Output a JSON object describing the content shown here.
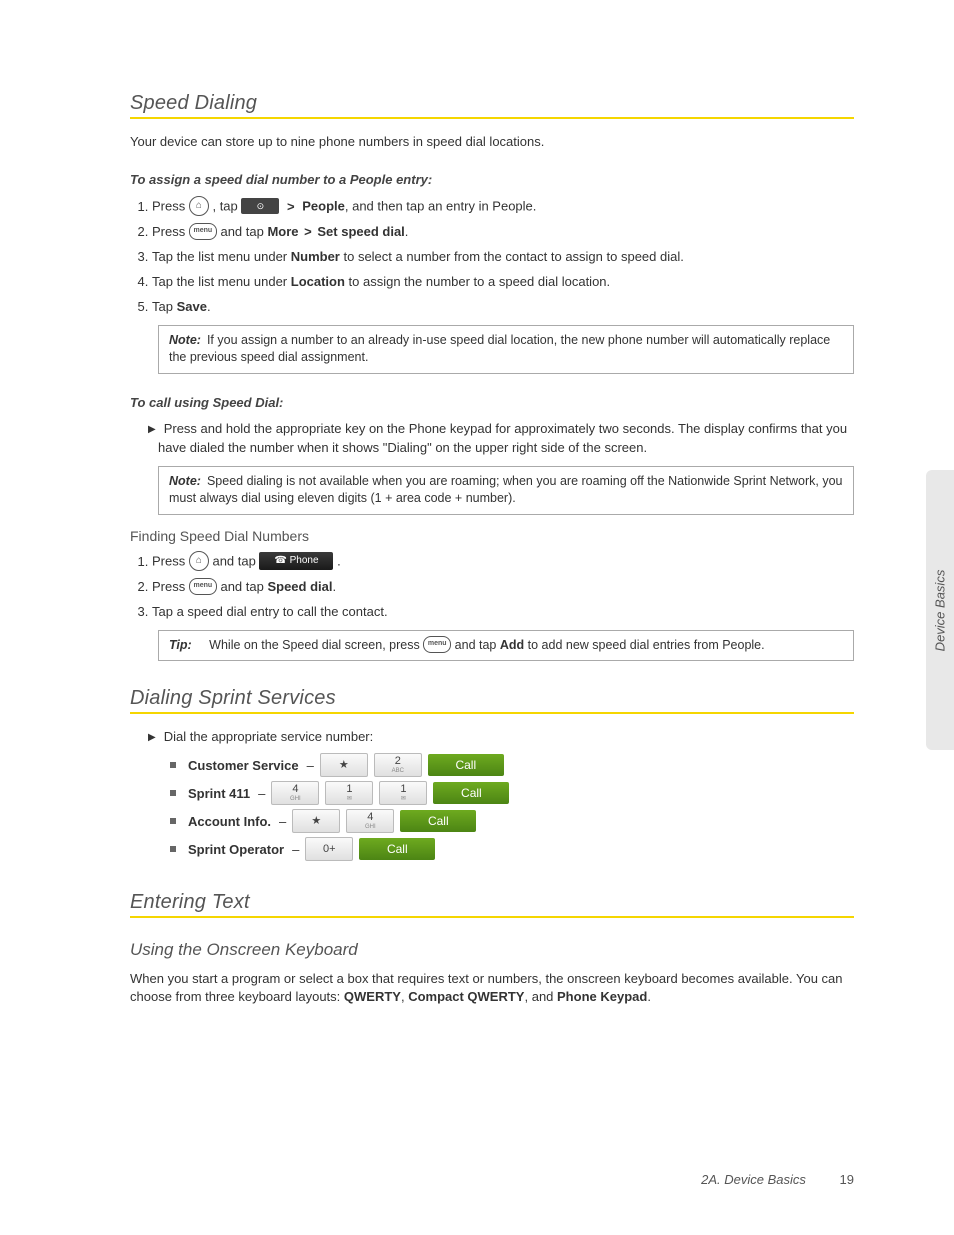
{
  "sideTab": "Device Basics",
  "footer": {
    "section": "2A. Device Basics",
    "page": "19"
  },
  "speedDialing": {
    "heading": "Speed Dialing",
    "intro": "Your device can store up to nine phone numbers in speed dial locations.",
    "assignHead": "To assign a speed dial number to a People entry:",
    "step1a": "Press ",
    "step1b": ", tap ",
    "step1c": "People",
    "step1d": ", and then tap an entry in People.",
    "step2a": "Press ",
    "step2b": " and tap ",
    "step2c": "More",
    "step2d": "Set speed dial",
    "step3a": "Tap the list menu under ",
    "step3b": "Number",
    "step3c": " to select a number from the contact to assign to speed dial.",
    "step4a": "Tap the list menu under ",
    "step4b": "Location",
    "step4c": " to assign the number to a speed dial location.",
    "step5a": "Tap ",
    "step5b": "Save",
    "note1Label": "Note:",
    "note1": "If you assign a number to an already in-use speed dial location, the new phone number will automatically replace the previous speed dial assignment.",
    "callHead": "To call using Speed Dial:",
    "callBody": "Press and hold the appropriate key on the Phone keypad for approximately two seconds. The display confirms that you have dialed the number when it shows \"Dialing\" on the upper right side of the screen.",
    "note2Label": "Note:",
    "note2": "Speed dialing is not available when you are roaming; when you are roaming off the Nationwide Sprint Network, you must always dial using eleven digits (1 + area code + number).",
    "findHead": "Finding Speed Dial Numbers",
    "find1a": "Press ",
    "find1b": " and tap ",
    "find2a": "Press ",
    "find2b": " and tap ",
    "find2c": "Speed dial",
    "find3": "Tap a speed dial entry to call the contact.",
    "tipLabel": "Tip:",
    "tipA": "While on the Speed dial screen, press ",
    "tipB": " and tap ",
    "tipC": "Add",
    "tipD": " to add new speed dial entries from People."
  },
  "dialingServices": {
    "heading": "Dialing Sprint Services",
    "intro": "Dial the appropriate service number:",
    "rows": [
      {
        "name": "Customer Service",
        "keys": [
          {
            "main": "★",
            "sub": ""
          },
          {
            "main": "2",
            "sub": "ABC"
          }
        ]
      },
      {
        "name": "Sprint 411",
        "keys": [
          {
            "main": "4",
            "sub": "GHI"
          },
          {
            "main": "1",
            "sub": "✉"
          },
          {
            "main": "1",
            "sub": "✉"
          }
        ]
      },
      {
        "name": "Account Info.",
        "keys": [
          {
            "main": "★",
            "sub": ""
          },
          {
            "main": "4",
            "sub": "GHI"
          }
        ]
      },
      {
        "name": "Sprint Operator",
        "keys": [
          {
            "main": "0+",
            "sub": ""
          }
        ]
      }
    ],
    "callLabel": "Call"
  },
  "enteringText": {
    "heading": "Entering Text",
    "sub": "Using the Onscreen Keyboard",
    "bodyA": "When you start a program or select a box that requires text or numbers, the onscreen keyboard becomes available. You can choose from three keyboard layouts: ",
    "kw1": "QWERTY",
    "kw2": "Compact QWERTY",
    "kw3": "Phone Keypad",
    "and": ", and ",
    "comma": ", "
  },
  "icons": {
    "home": "⌂",
    "menu": "menu",
    "apps": "⊙",
    "phone": "☎ Phone",
    "gt": ">"
  }
}
